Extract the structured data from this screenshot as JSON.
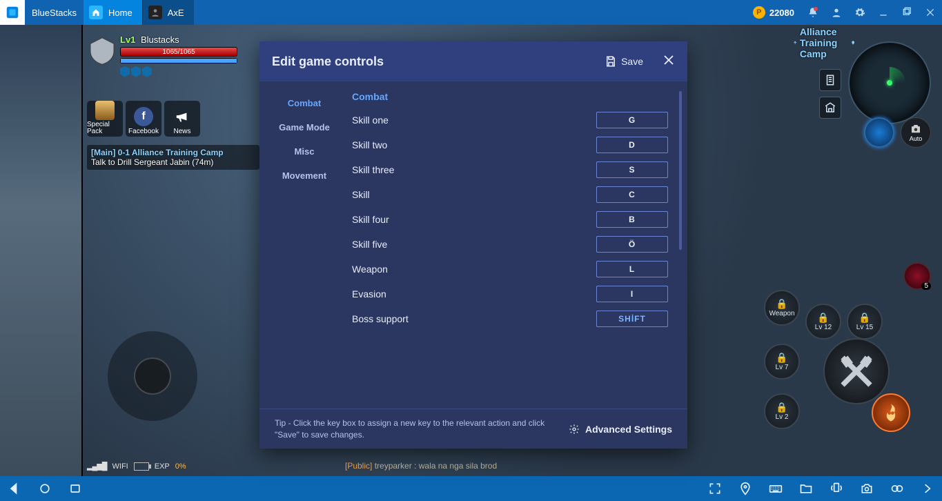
{
  "topbar": {
    "brand": "BlueStacks",
    "tabs": [
      {
        "label": "Home",
        "active": true
      },
      {
        "label": "AxE",
        "active": false
      }
    ],
    "points": "22080"
  },
  "hud": {
    "level": "Lv1",
    "player_name": "Blustacks",
    "hp_text": "1065/1065",
    "shortcuts": [
      {
        "label": "Special Pack"
      },
      {
        "label": "Facebook"
      },
      {
        "label": "News"
      }
    ],
    "quest_title": "[Main] 0-1 Alliance Training Camp",
    "quest_sub": "Talk to Drill Sergeant Jabin (74m)",
    "map_name": "Alliance Training Camp",
    "auto_label": "Auto",
    "skill_labels": {
      "weapon": "Weapon",
      "lv12": "Lv 12",
      "lv15": "Lv 15",
      "lv7": "Lv 7",
      "lv2": "Lv 2"
    },
    "potion_count": "5",
    "wifi_label": "WIFI",
    "exp_label": "EXP",
    "exp_value": "0%",
    "chat_channel": "[Public]",
    "chat_user": "treyparker :",
    "chat_msg": "wala na nga sila brod"
  },
  "modal": {
    "title": "Edit game controls",
    "save_label": "Save",
    "side": [
      "Combat",
      "Game Mode",
      "Misc",
      "Movement"
    ],
    "side_active": 0,
    "section_title": "Combat",
    "rows": [
      {
        "label": "Skill one",
        "key": "G"
      },
      {
        "label": "Skill two",
        "key": "D"
      },
      {
        "label": "Skill three",
        "key": "S"
      },
      {
        "label": "Skill",
        "key": "C"
      },
      {
        "label": "Skill four",
        "key": "B"
      },
      {
        "label": "Skill five",
        "key": "Ö"
      },
      {
        "label": "Weapon",
        "key": "L"
      },
      {
        "label": "Evasion",
        "key": "I"
      },
      {
        "label": "Boss support",
        "key": "SHİFT",
        "selected": true
      }
    ],
    "tip": "Tip - Click the key box to assign a new key to the relevant action and click \"Save\" to save changes.",
    "advanced_label": "Advanced Settings"
  }
}
